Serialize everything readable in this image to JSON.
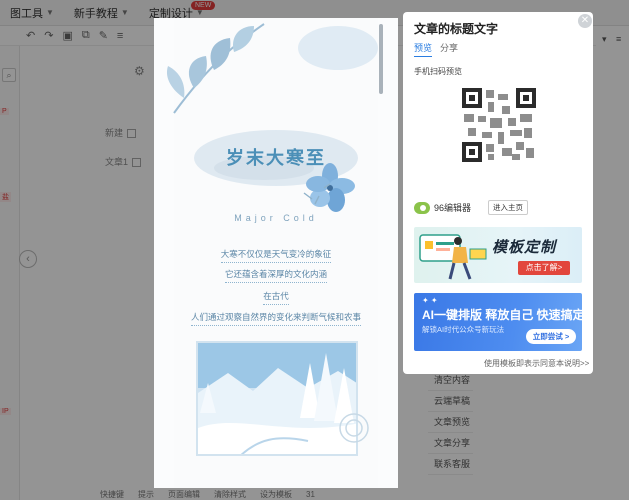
{
  "menubar": {
    "items": [
      {
        "label": "图工具"
      },
      {
        "label": "新手教程"
      },
      {
        "label": "定制设计"
      }
    ],
    "new_badge": "NEW"
  },
  "left_panel": {
    "tag1": "P",
    "tag2": "盐",
    "tag3": "IP"
  },
  "side_labels": {
    "new_label": "新建",
    "article_label": "文章1"
  },
  "right_panel": {
    "items": [
      "清空内容",
      "云端草稿",
      "文章预览",
      "文章分享",
      "联系客服"
    ]
  },
  "bottom_bar": {
    "items": [
      "快捷键",
      "提示",
      "页面编辑",
      "清除样式",
      "设为模板"
    ],
    "count": "31"
  },
  "article": {
    "title": "岁末大寒至",
    "subtitle": "Major Cold",
    "lines": [
      "大寒不仅仅是天气变冷的象征",
      "它还蕴含着深厚的文化内涵",
      "在古代",
      "人们通过观察自然界的变化来判断气候和农事"
    ]
  },
  "share_card": {
    "title": "文章的标题文字",
    "tabs": [
      {
        "label": "预览",
        "active": true
      },
      {
        "label": "分享",
        "active": false
      }
    ],
    "scan_label": "手机扫码预览",
    "brand_name": "96编辑器",
    "enter_button": "进入主页",
    "banner1": {
      "title": "模板定制",
      "button": "点击了解>"
    },
    "banner2": {
      "title": "AI一键排版 释放自己 快速搞定",
      "subtitle": "解锁AI时代公众号新玩法",
      "button": "立即尝试 >"
    },
    "footer_link": "使用模板即表示同意本说明>>"
  },
  "colors": {
    "accent_blue": "#2a7de1",
    "title_blue": "#4b8fb7",
    "banner_red": "#e2463c",
    "overlay": "rgba(0,0,0,0.42)"
  }
}
